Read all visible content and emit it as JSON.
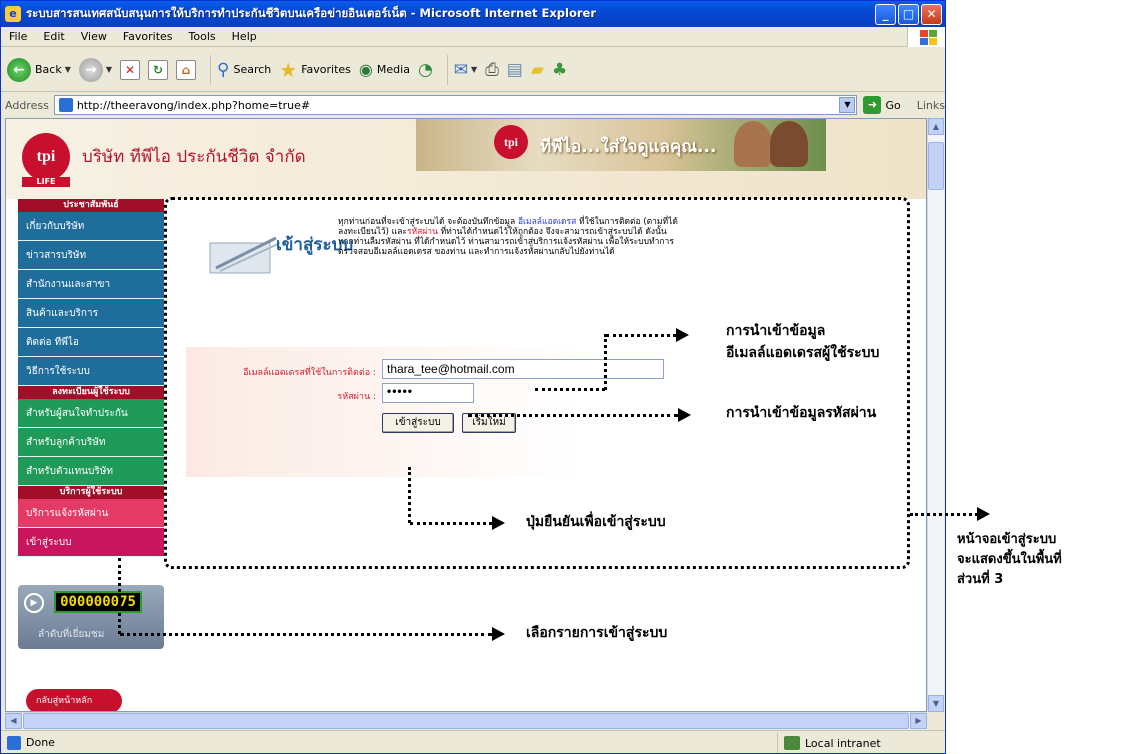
{
  "window": {
    "title": "ระบบสารสนเทศสนับสนุนการให้บริการทำประกันชีวิตบนเครือข่ายอินเตอร์เน็ต - Microsoft Internet Explorer",
    "menu": [
      "File",
      "Edit",
      "View",
      "Favorites",
      "Tools",
      "Help"
    ],
    "toolbar": {
      "back": "Back",
      "search": "Search",
      "favorites": "Favorites",
      "media": "Media"
    },
    "address_label": "Address",
    "address_url": "http://theeravong/index.php?home=true#",
    "go_label": "Go",
    "links_label": "Links",
    "status_text": "Done",
    "zone_text": "Local intranet"
  },
  "site": {
    "company_name": "บริษัท ทีพีไอ ประกันชีวิต จำกัด",
    "logo_text": "tpi",
    "logo_sub": "LIFE",
    "banner_slogan": "ทีพีไอ...ใส่ใจดูแลคุณ..."
  },
  "sidebar": {
    "sections": [
      {
        "heading": "ประชาสัมพันธ์",
        "items": [
          "เกี่ยวกับบริษัท",
          "ข่าวสารบริษัท",
          "สำนักงานและสาขา",
          "สินค้าและบริการ",
          "ติดต่อ ทีพีไอ",
          "วิธีการใช้ระบบ"
        ]
      },
      {
        "heading": "ลงทะเบียนผู้ใช้ระบบ",
        "items": [
          "สำหรับผู้สนใจทำประกัน",
          "สำหรับลูกค้าบริษัท",
          "สำหรับตัวแทนบริษัท"
        ]
      },
      {
        "heading": "บริการผู้ใช้ระบบ",
        "items": [
          "บริการแจ้งรหัสผ่าน",
          "เข้าสู่ระบบ"
        ]
      }
    ],
    "counter_value": "000000075",
    "counter_label": "ลำดับที่เยี่ยมชม",
    "home_button": "กลับสู่หน้าหลัก"
  },
  "login": {
    "title": "เข้าสู่ระบบ",
    "desc_part1": "ทุกท่านก่อนที่จะเข้าสู่ระบบได้ จะต้องบันทึกข้อมูล ",
    "desc_email": "อีเมลล์แอดเดรส",
    "desc_part2": " ที่ใช้ในการติดต่อ (ตามที่ได้ลงทะเบียนไว้) และ",
    "desc_password": "รหัสผ่าน",
    "desc_part3": " ที่ท่านได้กำหนดไว้ให้ถูกต้อง จึงจะสามารถเข้าสู่ระบบได้ ดังนั้น หากท่านลืมรหัสผ่าน ที่ได้กำหนดไว้ ท่านสามารถเข้าสู่บริการแจ้งรหัสผ่าน เพื่อให้ระบบทำการตรวจสอบอีเมลล์แอดเดรส ของท่าน และทำการแจ้งรหัสผ่านกลับไปยังท่านได้",
    "email_label": "อีเมลล์แอดเดรสที่ใช้ในการติดต่อ :",
    "email_value": "thara_tee@hotmail.com",
    "password_label": "รหัสผ่าน :",
    "password_value": "•••••",
    "submit_label": "เข้าสู่ระบบ",
    "reset_label": "เริ่มใหม่"
  },
  "annotations": {
    "email_callout_line1": "การนำเข้าข้อมูล",
    "email_callout_line2": "อีเมลล์แอดเดรสผู้ใช้ระบบ",
    "password_callout": "การนำเข้าข้อมูลรหัสผ่าน",
    "button_callout": "ปุ่มยืนยันเพื่อเข้าสู่ระบบ",
    "menu_callout": "เลือกรายการเข้าสู่ระบบ",
    "screen_callout_line1": "หน้าจอเข้าสู่ระบบ",
    "screen_callout_line2": "จะแสดงขึ้นในพื้นที่",
    "screen_callout_line3": "ส่วนที่ 3"
  }
}
